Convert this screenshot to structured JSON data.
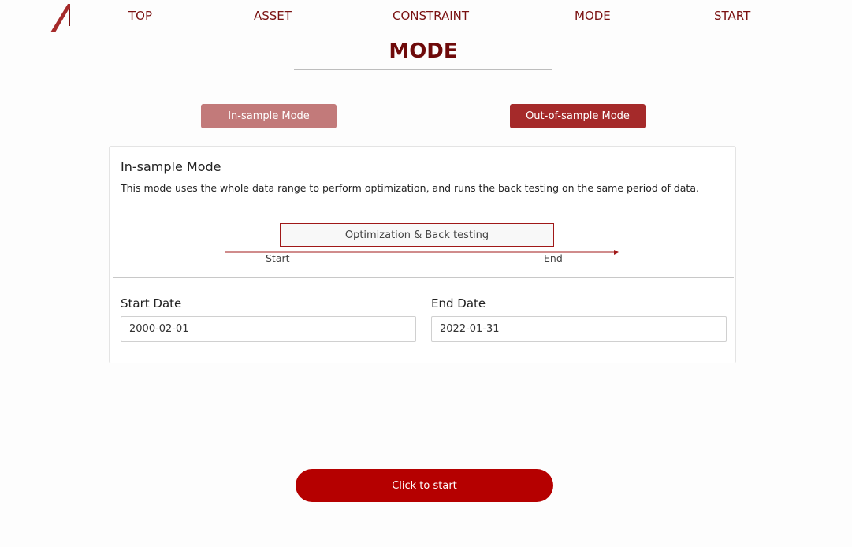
{
  "nav": {
    "items": [
      {
        "label": "TOP"
      },
      {
        "label": "ASSET"
      },
      {
        "label": "CONSTRAINT"
      },
      {
        "label": "MODE"
      },
      {
        "label": "START"
      }
    ]
  },
  "page": {
    "title": "MODE"
  },
  "mode_buttons": {
    "in_sample": "In-sample Mode",
    "out_of_sample": "Out-of-sample Mode"
  },
  "card": {
    "title": "In-sample Mode",
    "description": "This mode uses the whole data range to perform optimization, and runs the back testing on the same period of data.",
    "diagram": {
      "box_label": "Optimization & Back testing",
      "start_label": "Start",
      "end_label": "End"
    },
    "start_date": {
      "label": "Start Date",
      "value": "2000-02-01"
    },
    "end_date": {
      "label": "End Date",
      "value": "2022-01-31"
    }
  },
  "start_button": {
    "label": "Click to start"
  },
  "colors": {
    "nav_text": "#7a1212",
    "title": "#6e0a0a",
    "in_sample_button": "#c27a7a",
    "out_of_sample_button": "#a52a2a",
    "start_button": "#b50000"
  },
  "icons": {
    "logo": "brand-logo"
  }
}
